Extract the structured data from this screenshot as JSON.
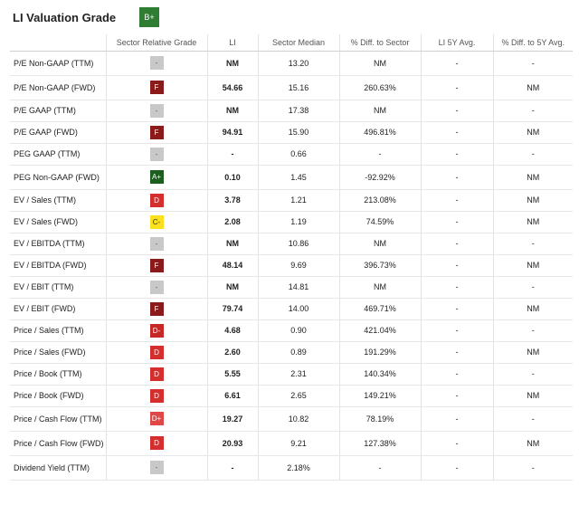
{
  "header": {
    "title": "LI Valuation Grade",
    "grade": "B+",
    "grade_color": "#2e7d32"
  },
  "columns": [
    "",
    "Sector Relative Grade",
    "LI",
    "Sector Median",
    "% Diff. to Sector",
    "LI 5Y Avg.",
    "% Diff. to 5Y Avg."
  ],
  "rows": [
    {
      "metric": "P/E Non-GAAP (TTM)",
      "grade": "-",
      "li": "NM",
      "median": "13.20",
      "diff_sector": "NM",
      "avg5y": "-",
      "diff_5y": "-"
    },
    {
      "metric": "P/E Non-GAAP (FWD)",
      "grade": "F",
      "li": "54.66",
      "median": "15.16",
      "diff_sector": "260.63%",
      "avg5y": "-",
      "diff_5y": "NM"
    },
    {
      "metric": "P/E GAAP (TTM)",
      "grade": "-",
      "li": "NM",
      "median": "17.38",
      "diff_sector": "NM",
      "avg5y": "-",
      "diff_5y": "-"
    },
    {
      "metric": "P/E GAAP (FWD)",
      "grade": "F",
      "li": "94.91",
      "median": "15.90",
      "diff_sector": "496.81%",
      "avg5y": "-",
      "diff_5y": "NM"
    },
    {
      "metric": "PEG GAAP (TTM)",
      "grade": "-",
      "li": "-",
      "median": "0.66",
      "diff_sector": "-",
      "avg5y": "-",
      "diff_5y": "-"
    },
    {
      "metric": "PEG Non-GAAP (FWD)",
      "grade": "A+",
      "li": "0.10",
      "median": "1.45",
      "diff_sector": "-92.92%",
      "avg5y": "-",
      "diff_5y": "NM"
    },
    {
      "metric": "EV / Sales (TTM)",
      "grade": "D",
      "li": "3.78",
      "median": "1.21",
      "diff_sector": "213.08%",
      "avg5y": "-",
      "diff_5y": "NM"
    },
    {
      "metric": "EV / Sales (FWD)",
      "grade": "C-",
      "li": "2.08",
      "median": "1.19",
      "diff_sector": "74.59%",
      "avg5y": "-",
      "diff_5y": "NM"
    },
    {
      "metric": "EV / EBITDA (TTM)",
      "grade": "-",
      "li": "NM",
      "median": "10.86",
      "diff_sector": "NM",
      "avg5y": "-",
      "diff_5y": "-"
    },
    {
      "metric": "EV / EBITDA (FWD)",
      "grade": "F",
      "li": "48.14",
      "median": "9.69",
      "diff_sector": "396.73%",
      "avg5y": "-",
      "diff_5y": "NM"
    },
    {
      "metric": "EV / EBIT (TTM)",
      "grade": "-",
      "li": "NM",
      "median": "14.81",
      "diff_sector": "NM",
      "avg5y": "-",
      "diff_5y": "-"
    },
    {
      "metric": "EV / EBIT (FWD)",
      "grade": "F",
      "li": "79.74",
      "median": "14.00",
      "diff_sector": "469.71%",
      "avg5y": "-",
      "diff_5y": "NM"
    },
    {
      "metric": "Price / Sales (TTM)",
      "grade": "D-",
      "li": "4.68",
      "median": "0.90",
      "diff_sector": "421.04%",
      "avg5y": "-",
      "diff_5y": "-"
    },
    {
      "metric": "Price / Sales (FWD)",
      "grade": "D",
      "li": "2.60",
      "median": "0.89",
      "diff_sector": "191.29%",
      "avg5y": "-",
      "diff_5y": "NM"
    },
    {
      "metric": "Price / Book (TTM)",
      "grade": "D",
      "li": "5.55",
      "median": "2.31",
      "diff_sector": "140.34%",
      "avg5y": "-",
      "diff_5y": "-"
    },
    {
      "metric": "Price / Book (FWD)",
      "grade": "D",
      "li": "6.61",
      "median": "2.65",
      "diff_sector": "149.21%",
      "avg5y": "-",
      "diff_5y": "NM"
    },
    {
      "metric": "Price / Cash Flow (TTM)",
      "grade": "D+",
      "li": "19.27",
      "median": "10.82",
      "diff_sector": "78.19%",
      "avg5y": "-",
      "diff_5y": "-"
    },
    {
      "metric": "Price / Cash Flow (FWD)",
      "grade": "D",
      "li": "20.93",
      "median": "9.21",
      "diff_sector": "127.38%",
      "avg5y": "-",
      "diff_5y": "NM"
    },
    {
      "metric": "Dividend Yield (TTM)",
      "grade": "-",
      "li": "-",
      "median": "2.18%",
      "diff_sector": "-",
      "avg5y": "-",
      "diff_5y": "-"
    }
  ]
}
